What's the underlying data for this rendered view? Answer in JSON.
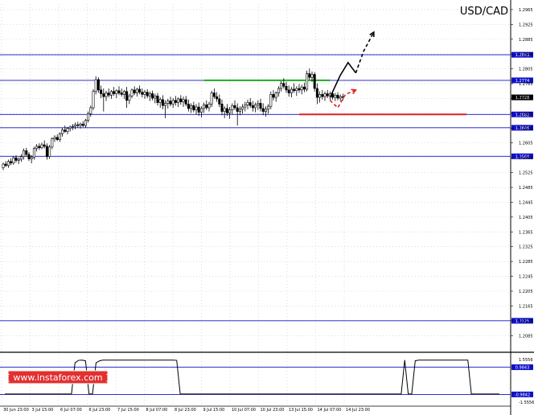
{
  "chart_data": {
    "type": "candlestick",
    "title": "USD/CAD",
    "watermark": "[  www.instaforex.com ]",
    "y_range": [
      1.204,
      1.298
    ],
    "y_ticks": [
      "1.2965",
      "1.2925",
      "1.2885",
      "1.2845",
      "1.2805",
      "1.2765",
      "1.2725",
      "1.2685",
      "1.2645",
      "1.2605",
      "1.2565",
      "1.2525",
      "1.2485",
      "1.2445",
      "1.2405",
      "1.2365",
      "1.2325",
      "1.2285",
      "1.2245",
      "1.2205",
      "1.2165",
      "1.2125",
      "1.2085"
    ],
    "x_labels": [
      "30 Jun 23:00",
      "3 Jul 15:00",
      "6 Jul 07:00",
      "6 Jul 23:00",
      "7 Jul 15:00",
      "8 Jul 07:00",
      "8 Jul 23:00",
      "9 Jul 15:00",
      "10 Jul 07:00",
      "10 Jul 23:00",
      "13 Jul 15:00",
      "14 Jul 07:00",
      "14 Jul 23:00"
    ],
    "levels": [
      {
        "value": 1.2843,
        "label": "1.2843",
        "color": "#1010c8",
        "kind": "resistance"
      },
      {
        "value": 1.2774,
        "label": "1.2774",
        "color": "#1010c8",
        "kind": "resistance"
      },
      {
        "value": 1.2728,
        "label": "1.2728",
        "color": "#000000",
        "kind": "current-price"
      },
      {
        "value": 1.2682,
        "label": "1.2682",
        "color": "#1010c8",
        "kind": "support"
      },
      {
        "value": 1.2646,
        "label": "1.2646",
        "color": "#1010c8",
        "kind": "support"
      },
      {
        "value": 1.2569,
        "label": "1.2569",
        "color": "#1010c8",
        "kind": "support"
      },
      {
        "value": 1.2125,
        "label": "1.2125",
        "color": "#1010c8",
        "kind": "support"
      }
    ],
    "zones": [
      {
        "from_index": 78,
        "to_index": 127,
        "value": 1.2774,
        "color": "#22aa22"
      },
      {
        "from_index": 115,
        "to_index": 180,
        "value": 1.2682,
        "color": "#e02020"
      }
    ],
    "candles": [
      [
        1.2538,
        1.2552,
        1.2532,
        1.2548
      ],
      [
        1.2548,
        1.2556,
        1.254,
        1.2544
      ],
      [
        1.2544,
        1.256,
        1.2538,
        1.2555
      ],
      [
        1.2555,
        1.2563,
        1.2545,
        1.2551
      ],
      [
        1.2551,
        1.257,
        1.2546,
        1.2565
      ],
      [
        1.2565,
        1.2572,
        1.2552,
        1.2558
      ],
      [
        1.2558,
        1.2566,
        1.2548,
        1.2561
      ],
      [
        1.2561,
        1.2575,
        1.2554,
        1.2568
      ],
      [
        1.2568,
        1.259,
        1.256,
        1.2584
      ],
      [
        1.2584,
        1.2592,
        1.2568,
        1.2574
      ],
      [
        1.2574,
        1.258,
        1.2556,
        1.2562
      ],
      [
        1.2562,
        1.2572,
        1.255,
        1.2566
      ],
      [
        1.2566,
        1.2595,
        1.256,
        1.259
      ],
      [
        1.259,
        1.2602,
        1.2582,
        1.2596
      ],
      [
        1.2596,
        1.2604,
        1.2586,
        1.2592
      ],
      [
        1.2592,
        1.2606,
        1.2588,
        1.26
      ],
      [
        1.26,
        1.2612,
        1.259,
        1.2596
      ],
      [
        1.2596,
        1.2604,
        1.256,
        1.2568
      ],
      [
        1.2568,
        1.26,
        1.2562,
        1.2594
      ],
      [
        1.2594,
        1.262,
        1.2588,
        1.2616
      ],
      [
        1.2616,
        1.2626,
        1.2608,
        1.262
      ],
      [
        1.262,
        1.2628,
        1.261,
        1.2614
      ],
      [
        1.2614,
        1.2634,
        1.2608,
        1.263
      ],
      [
        1.263,
        1.2646,
        1.2622,
        1.264
      ],
      [
        1.264,
        1.2652,
        1.2632,
        1.2636
      ],
      [
        1.2636,
        1.2648,
        1.2628,
        1.2644
      ],
      [
        1.2644,
        1.2652,
        1.2636,
        1.2648
      ],
      [
        1.2648,
        1.2656,
        1.264,
        1.265
      ],
      [
        1.265,
        1.266,
        1.2642,
        1.2654
      ],
      [
        1.2654,
        1.2662,
        1.2646,
        1.2652
      ],
      [
        1.2652,
        1.266,
        1.2644,
        1.2656
      ],
      [
        1.2656,
        1.2664,
        1.2648,
        1.2652
      ],
      [
        1.2652,
        1.267,
        1.2646,
        1.2666
      ],
      [
        1.2666,
        1.269,
        1.266,
        1.2684
      ],
      [
        1.2684,
        1.2706,
        1.2676,
        1.27
      ],
      [
        1.27,
        1.275,
        1.2694,
        1.2744
      ],
      [
        1.2744,
        1.2785,
        1.2736,
        1.2776
      ],
      [
        1.2776,
        1.2782,
        1.274,
        1.2748
      ],
      [
        1.2748,
        1.276,
        1.2726,
        1.2738
      ],
      [
        1.2738,
        1.2752,
        1.269,
        1.273
      ],
      [
        1.273,
        1.2746,
        1.2718,
        1.274
      ],
      [
        1.274,
        1.2752,
        1.2728,
        1.2734
      ],
      [
        1.2734,
        1.2748,
        1.2724,
        1.2744
      ],
      [
        1.2744,
        1.2756,
        1.2732,
        1.2738
      ],
      [
        1.2738,
        1.275,
        1.2726,
        1.2746
      ],
      [
        1.2746,
        1.2758,
        1.2734,
        1.274
      ],
      [
        1.274,
        1.2752,
        1.273,
        1.2736
      ],
      [
        1.2736,
        1.2748,
        1.2724,
        1.2744
      ],
      [
        1.2744,
        1.2756,
        1.27,
        1.272
      ],
      [
        1.272,
        1.2738,
        1.271,
        1.2732
      ],
      [
        1.2732,
        1.2752,
        1.2726,
        1.2748
      ],
      [
        1.2748,
        1.2758,
        1.2734,
        1.274
      ],
      [
        1.274,
        1.2754,
        1.273,
        1.275
      ],
      [
        1.275,
        1.276,
        1.2736,
        1.2742
      ],
      [
        1.2742,
        1.2752,
        1.2728,
        1.2736
      ],
      [
        1.2736,
        1.2748,
        1.2724,
        1.2742
      ],
      [
        1.2742,
        1.275,
        1.2726,
        1.2732
      ],
      [
        1.2732,
        1.2744,
        1.2718,
        1.2738
      ],
      [
        1.2738,
        1.2746,
        1.272,
        1.2726
      ],
      [
        1.2726,
        1.2738,
        1.2712,
        1.2732
      ],
      [
        1.2732,
        1.274,
        1.2706,
        1.2714
      ],
      [
        1.2714,
        1.2728,
        1.27,
        1.2722
      ],
      [
        1.2722,
        1.2734,
        1.2696,
        1.2706
      ],
      [
        1.2706,
        1.272,
        1.2672,
        1.2712
      ],
      [
        1.2712,
        1.2724,
        1.2698,
        1.2718
      ],
      [
        1.2718,
        1.273,
        1.2704,
        1.271
      ],
      [
        1.271,
        1.2726,
        1.27,
        1.272
      ],
      [
        1.272,
        1.2732,
        1.2706,
        1.2714
      ],
      [
        1.2714,
        1.2728,
        1.2702,
        1.2724
      ],
      [
        1.2724,
        1.2734,
        1.2708,
        1.2716
      ],
      [
        1.2716,
        1.273,
        1.2702,
        1.2722
      ],
      [
        1.2722,
        1.2732,
        1.2704,
        1.271
      ],
      [
        1.271,
        1.2722,
        1.269,
        1.2698
      ],
      [
        1.2698,
        1.2712,
        1.2686,
        1.2706
      ],
      [
        1.2706,
        1.2716,
        1.2688,
        1.2694
      ],
      [
        1.2694,
        1.271,
        1.2682,
        1.2702
      ],
      [
        1.2702,
        1.2714,
        1.2678,
        1.2688
      ],
      [
        1.2688,
        1.2704,
        1.2674,
        1.2698
      ],
      [
        1.2698,
        1.2714,
        1.2686,
        1.2708
      ],
      [
        1.2708,
        1.272,
        1.2694,
        1.27
      ],
      [
        1.27,
        1.2716,
        1.269,
        1.271
      ],
      [
        1.271,
        1.2746,
        1.2702,
        1.274
      ],
      [
        1.274,
        1.2752,
        1.2724,
        1.273
      ],
      [
        1.273,
        1.2742,
        1.2716,
        1.2724
      ],
      [
        1.2724,
        1.2736,
        1.2702,
        1.271
      ],
      [
        1.271,
        1.2722,
        1.268,
        1.269
      ],
      [
        1.269,
        1.2704,
        1.2672,
        1.2698
      ],
      [
        1.2698,
        1.271,
        1.2678,
        1.2686
      ],
      [
        1.2686,
        1.2702,
        1.267,
        1.2694
      ],
      [
        1.2694,
        1.2712,
        1.2682,
        1.2706
      ],
      [
        1.2706,
        1.272,
        1.2694,
        1.27
      ],
      [
        1.27,
        1.2712,
        1.2652,
        1.269
      ],
      [
        1.269,
        1.2704,
        1.268,
        1.2696
      ],
      [
        1.2696,
        1.271,
        1.2684,
        1.2702
      ],
      [
        1.2702,
        1.2716,
        1.269,
        1.2708
      ],
      [
        1.2708,
        1.2722,
        1.2696,
        1.2714
      ],
      [
        1.2714,
        1.2726,
        1.27,
        1.2706
      ],
      [
        1.2706,
        1.2718,
        1.269,
        1.27
      ],
      [
        1.27,
        1.2714,
        1.2688,
        1.2708
      ],
      [
        1.2708,
        1.272,
        1.2694,
        1.2712
      ],
      [
        1.2712,
        1.2724,
        1.269,
        1.2698
      ],
      [
        1.2698,
        1.2712,
        1.268,
        1.269
      ],
      [
        1.269,
        1.2704,
        1.2676,
        1.2696
      ],
      [
        1.2696,
        1.271,
        1.2684,
        1.2704
      ],
      [
        1.2704,
        1.2744,
        1.2696,
        1.2736
      ],
      [
        1.2736,
        1.2748,
        1.272,
        1.2728
      ],
      [
        1.2728,
        1.2744,
        1.2716,
        1.274
      ],
      [
        1.274,
        1.2758,
        1.273,
        1.2752
      ],
      [
        1.2752,
        1.2772,
        1.2744,
        1.2766
      ],
      [
        1.2766,
        1.278,
        1.2752,
        1.2758
      ],
      [
        1.2758,
        1.277,
        1.274,
        1.2748
      ],
      [
        1.2748,
        1.276,
        1.273,
        1.274
      ],
      [
        1.274,
        1.2756,
        1.2728,
        1.275
      ],
      [
        1.275,
        1.2766,
        1.274,
        1.2746
      ],
      [
        1.2746,
        1.2758,
        1.2732,
        1.2752
      ],
      [
        1.2752,
        1.2764,
        1.274,
        1.2748
      ],
      [
        1.2748,
        1.2762,
        1.2736,
        1.2756
      ],
      [
        1.2756,
        1.2768,
        1.2742,
        1.275
      ],
      [
        1.275,
        1.28,
        1.2744,
        1.2792
      ],
      [
        1.2792,
        1.2806,
        1.2776,
        1.2782
      ],
      [
        1.2782,
        1.2798,
        1.277,
        1.279
      ],
      [
        1.279,
        1.2796,
        1.2744,
        1.2752
      ],
      [
        1.2752,
        1.2766,
        1.271,
        1.2728
      ],
      [
        1.2728,
        1.2744,
        1.2714,
        1.2736
      ],
      [
        1.2736,
        1.2748,
        1.2722,
        1.273
      ],
      [
        1.273,
        1.2744,
        1.2718,
        1.2738
      ],
      [
        1.2738,
        1.2748,
        1.2726,
        1.2732
      ],
      [
        1.2732,
        1.2744,
        1.272,
        1.2738
      ],
      [
        1.2738,
        1.2746,
        1.2722,
        1.2728
      ],
      [
        1.2728,
        1.274,
        1.2718,
        1.2734
      ],
      [
        1.2734,
        1.2742,
        1.272,
        1.2726
      ],
      [
        1.2726,
        1.2736,
        1.2718,
        1.273
      ],
      [
        1.273,
        1.2738,
        1.272,
        1.2728
      ]
    ],
    "forecast_paths": [
      {
        "color": "#000000",
        "style": "solid",
        "points": [
          [
            127,
            1.2728
          ],
          [
            131,
            1.2788
          ],
          [
            134,
            1.2822
          ],
          [
            137,
            1.2794
          ]
        ]
      },
      {
        "color": "#000000",
        "style": "dashed",
        "points": [
          [
            137,
            1.2794
          ],
          [
            140,
            1.2852
          ],
          [
            144,
            1.2904
          ]
        ],
        "arrow": true
      },
      {
        "color": "#e02020",
        "style": "dashed",
        "points": [
          [
            127,
            1.272
          ],
          [
            130,
            1.27
          ],
          [
            133,
            1.2736
          ],
          [
            137,
            1.2748
          ]
        ],
        "arrow": true
      }
    ],
    "indicator": {
      "y_ticks": [
        "1.5556",
        "0.9843",
        "-0.9842",
        "-1.5556"
      ],
      "values": [
        -0.95,
        -0.95,
        -0.95,
        -0.95,
        -0.95,
        -0.95,
        -0.95,
        -0.95,
        -0.95,
        -0.95,
        -0.95,
        -0.95,
        -0.95,
        -0.95,
        -0.95,
        -0.95,
        -0.95,
        -0.95,
        -0.95,
        -0.95,
        1.3,
        1.48,
        1.5,
        1.45,
        -0.95,
        -0.95,
        1.3,
        1.45,
        1.5,
        1.5,
        1.5,
        1.5,
        1.5,
        1.5,
        1.5,
        1.5,
        1.5,
        1.5,
        1.5,
        1.5,
        1.5,
        1.5,
        1.5,
        1.5,
        1.5,
        1.5,
        1.5,
        1.5,
        1.5,
        1.48,
        -0.95,
        -0.95,
        -0.95,
        -0.95,
        -0.95,
        -0.95,
        -0.95,
        -0.95,
        -0.95,
        -0.95,
        -0.95,
        -0.95,
        -0.95,
        -0.95,
        -0.95,
        -0.95,
        -0.95,
        -0.95,
        -0.95,
        -0.95,
        -0.95,
        -0.95,
        -0.95,
        -0.95,
        -0.95,
        -0.95,
        -0.95,
        -0.95,
        -0.95,
        -0.95,
        -0.95,
        -0.95,
        -0.95,
        -0.95,
        -0.95,
        -0.95,
        -0.95,
        -0.95,
        -0.95,
        -0.95,
        -0.95,
        -0.95,
        -0.95,
        -0.95,
        -0.95,
        -0.95,
        -0.95,
        -0.95,
        -0.95,
        -0.95,
        -0.95,
        -0.95,
        -0.95,
        -0.95,
        -0.95,
        -0.95,
        -0.95,
        -0.95,
        -0.95,
        -0.95,
        -0.95,
        -0.95,
        -0.95,
        -0.95,
        1.5,
        -0.95,
        -0.95,
        1.45,
        1.5,
        1.5,
        1.5,
        1.5,
        1.5,
        1.5,
        1.5,
        1.5,
        1.5,
        1.5,
        1.5,
        1.5,
        1.5,
        1.5,
        1.5,
        -0.95,
        -0.95,
        -0.95,
        -0.95,
        -0.95,
        -0.95,
        -0.95,
        -0.95,
        -0.95
      ]
    }
  }
}
